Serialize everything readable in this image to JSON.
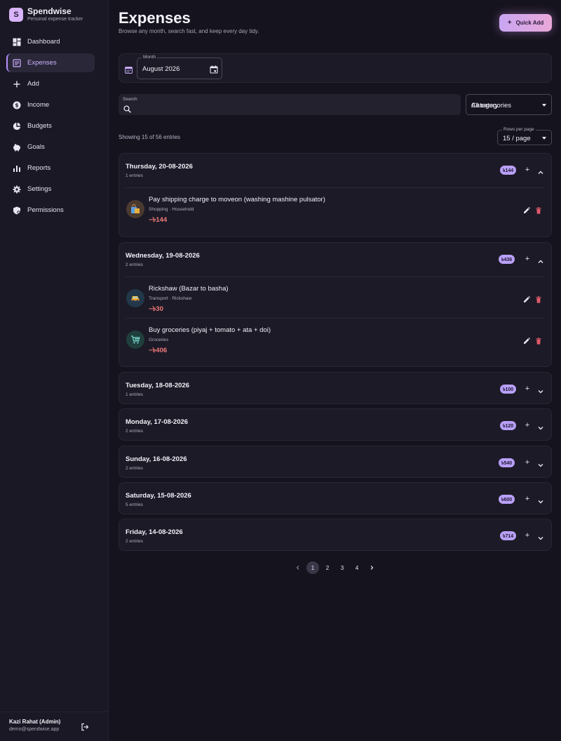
{
  "app": {
    "name": "Spendwise",
    "tagline": "Personal expense tracker",
    "logo_letter": "S"
  },
  "sidebar": {
    "items": [
      {
        "label": "Dashboard",
        "icon": "dashboard-icon"
      },
      {
        "label": "Expenses",
        "icon": "receipt-icon",
        "active": true
      },
      {
        "label": "Add",
        "icon": "plus-icon"
      },
      {
        "label": "Income",
        "icon": "dollar-icon"
      },
      {
        "label": "Budgets",
        "icon": "pie-chart-icon"
      },
      {
        "label": "Goals",
        "icon": "piggy-bank-icon"
      },
      {
        "label": "Reports",
        "icon": "bar-chart-icon"
      },
      {
        "label": "Settings",
        "icon": "gear-icon"
      },
      {
        "label": "Permissions",
        "icon": "shield-icon"
      }
    ]
  },
  "user": {
    "name": "Kazi Rahat (Admin)",
    "email": "demo@spendwise.app"
  },
  "header": {
    "title": "Expenses",
    "subtitle": "Browse any month, search fast, and keep every day tidy.",
    "quick_add": "Quick Add"
  },
  "filters": {
    "month_label": "Month",
    "month_value": "August 2026",
    "search_label": "Search",
    "category_value": "All categories",
    "category_overlap_label": "Category"
  },
  "list": {
    "showing": "Showing 15 of 56 entries",
    "rows_label": "Rows per page",
    "rows_value": "15 / page"
  },
  "days": [
    {
      "title": "Thursday, 20-08-2026",
      "count": "1 entries",
      "total": "৳144",
      "expanded": true,
      "entries": [
        {
          "title": "Pay shipping charge to moveon (washing mashine pulsator)",
          "meta": "Shopping · Household",
          "amount": "−৳144",
          "icon": "shopping-bag-icon"
        }
      ]
    },
    {
      "title": "Wednesday, 19-08-2026",
      "count": "2 entries",
      "total": "৳436",
      "expanded": true,
      "entries": [
        {
          "title": "Rickshaw (Bazar to basha)",
          "meta": "Transport · Rickshaw",
          "amount": "−৳30",
          "icon": "rickshaw-icon"
        },
        {
          "title": "Buy groceries (piyaj + tomato + ata + doi)",
          "meta": "Groceries",
          "amount": "−৳406",
          "icon": "cart-icon"
        }
      ]
    },
    {
      "title": "Tuesday, 18-08-2026",
      "count": "1 entries",
      "total": "৳100",
      "expanded": false,
      "entries": []
    },
    {
      "title": "Monday, 17-08-2026",
      "count": "2 entries",
      "total": "৳120",
      "expanded": false,
      "entries": []
    },
    {
      "title": "Sunday, 16-08-2026",
      "count": "2 entries",
      "total": "৳540",
      "expanded": false,
      "entries": []
    },
    {
      "title": "Saturday, 15-08-2026",
      "count": "5 entries",
      "total": "৳600",
      "expanded": false,
      "entries": []
    },
    {
      "title": "Friday, 14-08-2026",
      "count": "2 entries",
      "total": "৳714",
      "expanded": false,
      "entries": []
    }
  ],
  "pagination": {
    "pages": [
      "1",
      "2",
      "3",
      "4"
    ],
    "current": "1"
  },
  "colors": {
    "accent": "#b890ff",
    "negative": "#f07a7a",
    "badge": "#b8a0f8",
    "delete": "#e05a6a"
  }
}
